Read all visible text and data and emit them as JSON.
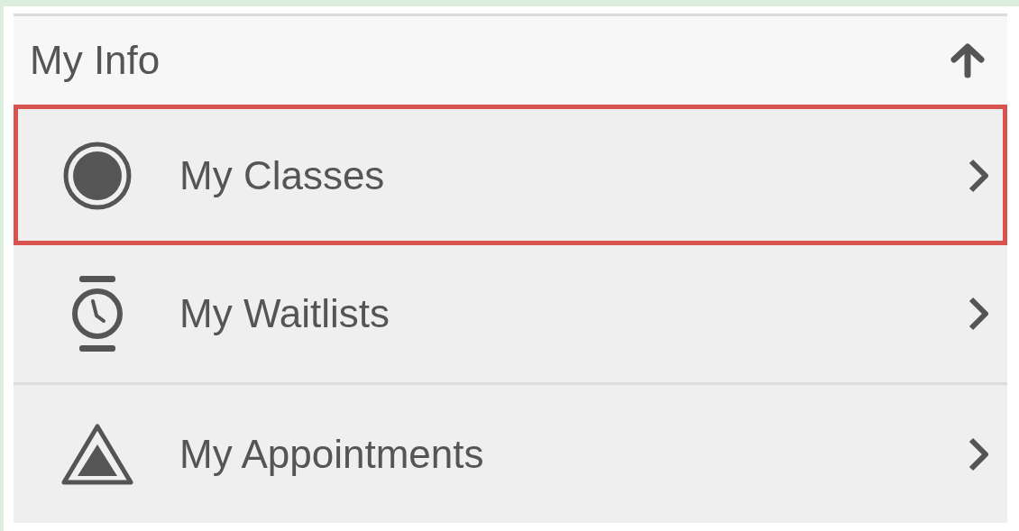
{
  "section": {
    "title": "My Info",
    "expanded": true
  },
  "items": [
    {
      "label": "My Classes",
      "kind": "circle",
      "highlighted": true
    },
    {
      "label": "My Waitlists",
      "kind": "watch",
      "highlighted": false
    },
    {
      "label": "My Appointments",
      "kind": "triangle",
      "highlighted": false
    }
  ]
}
